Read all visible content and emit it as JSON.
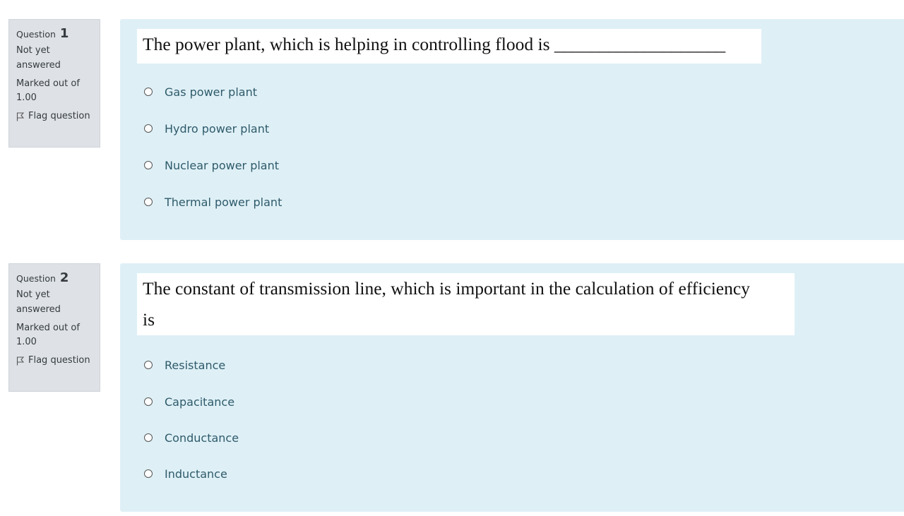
{
  "questions": [
    {
      "label": "Question",
      "number": "1",
      "state": "Not yet answered",
      "grade": "Marked out of 1.00",
      "flag": "Flag question",
      "text": "The power plant, which is helping in controlling flood is ___________________",
      "answers": [
        "Gas power plant",
        "Hydro power plant",
        "Nuclear power plant",
        "Thermal power plant"
      ]
    },
    {
      "label": "Question",
      "number": "2",
      "state": "Not yet answered",
      "grade": "Marked out of 1.00",
      "flag": "Flag question",
      "text_line1": "The constant of transmission line, which is important in the calculation of efficiency",
      "text_line2": "is",
      "answers": [
        "Resistance",
        "Capacitance",
        "Conductance",
        "Inductance"
      ]
    }
  ],
  "colors": {
    "info_bg": "#dee2e6",
    "content_bg": "#def0f6",
    "answer_text": "#2f5a6a"
  }
}
